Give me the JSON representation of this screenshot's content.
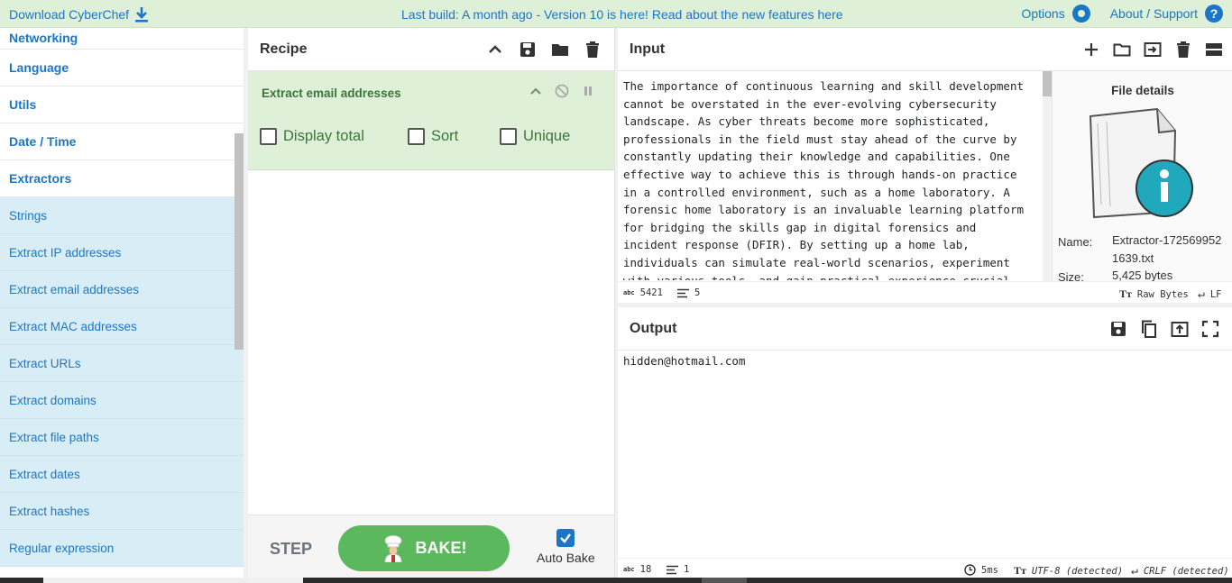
{
  "banner": {
    "download_label": "Download CyberChef",
    "center_text": "Last build: A month ago - Version 10 is here! Read about the new features here",
    "options_label": "Options",
    "about_label": "About / Support"
  },
  "sidebar": {
    "categories": [
      "Networking",
      "Language",
      "Utils",
      "Date / Time",
      "Extractors"
    ],
    "operations": [
      "Strings",
      "Extract IP addresses",
      "Extract email addresses",
      "Extract MAC addresses",
      "Extract URLs",
      "Extract domains",
      "Extract file paths",
      "Extract dates",
      "Extract hashes",
      "Regular expression"
    ]
  },
  "recipe": {
    "title": "Recipe",
    "operation": {
      "name": "Extract email addresses",
      "options": [
        {
          "label": "Display total",
          "checked": false
        },
        {
          "label": "Sort",
          "checked": false
        },
        {
          "label": "Unique",
          "checked": false
        }
      ]
    },
    "step_label": "STEP",
    "bake_label": "BAKE!",
    "autobake_label": "Auto Bake",
    "autobake_checked": true
  },
  "input": {
    "title": "Input",
    "text": "The importance of continuous learning and skill development cannot be overstated in the ever-evolving cybersecurity landscape. As cyber threats become more sophisticated, professionals in the field must stay ahead of the curve by constantly updating their knowledge and capabilities. One effective way to achieve this is through hands-on practice in a controlled environment, such as a home laboratory. A forensic home laboratory is an invaluable learning platform for bridging the skills gap in digital forensics and incident response (DFIR). By setting up a home lab, individuals can simulate real-world scenarios, experiment with various tools, and gain practical experience crucial",
    "file_details": {
      "title": "File details",
      "name_label": "Name:",
      "name_value": "Extractor-1725699521639.txt",
      "size_label": "Size:",
      "size_value": "5,425 bytes"
    },
    "status": {
      "chars": "5421",
      "lines": "5",
      "encoding": "Raw Bytes",
      "eol": "LF"
    }
  },
  "output": {
    "title": "Output",
    "text": "hidden@hotmail.com",
    "status": {
      "chars": "18",
      "lines": "1",
      "time": "5ms",
      "encoding": "UTF-8 (detected)",
      "eol": "CRLF (detected)"
    }
  },
  "colors": {
    "accent": "#1b76c8",
    "banner_bg": "#dff0d8",
    "recipe_op_bg": "#dff0d8",
    "recipe_op_text": "#3c763d",
    "operation_bg": "#d9edf7",
    "bake_green": "#5cb85c"
  }
}
